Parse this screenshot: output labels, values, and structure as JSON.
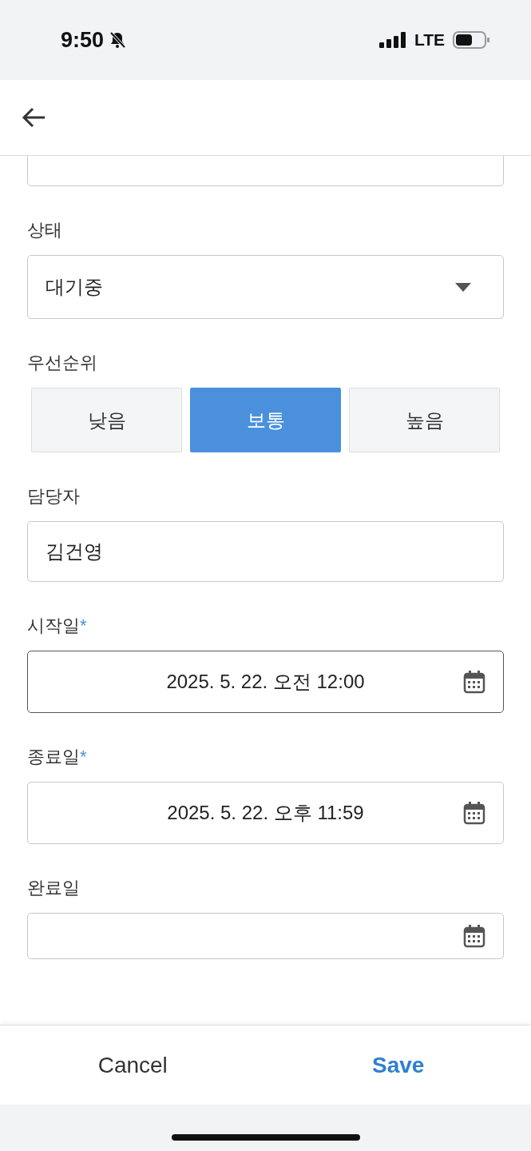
{
  "status_bar": {
    "time": "9:50",
    "network": "LTE"
  },
  "form": {
    "fields": [
      {
        "kind": "text"
      },
      {
        "kind": "select",
        "label": "상태",
        "value": "대기중"
      },
      {
        "kind": "segmented",
        "label": "우선순위",
        "options": [
          {
            "label": "낮음",
            "selected": false
          },
          {
            "label": "보통",
            "selected": true
          },
          {
            "label": "높음",
            "selected": false
          }
        ]
      },
      {
        "kind": "text",
        "label": "담당자",
        "value": "김건영"
      },
      {
        "kind": "date",
        "label": "시작일",
        "required_mark": "*",
        "value": "2025. 5. 22. 오전 12:00",
        "focused": true
      },
      {
        "kind": "date",
        "label": "종료일",
        "required_mark": "*",
        "value": "2025. 5. 22. 오후 11:59",
        "focused": false
      },
      {
        "kind": "date",
        "label": "완료일",
        "focused": false
      }
    ]
  },
  "actions": {
    "cancel": "Cancel",
    "save": "Save"
  }
}
